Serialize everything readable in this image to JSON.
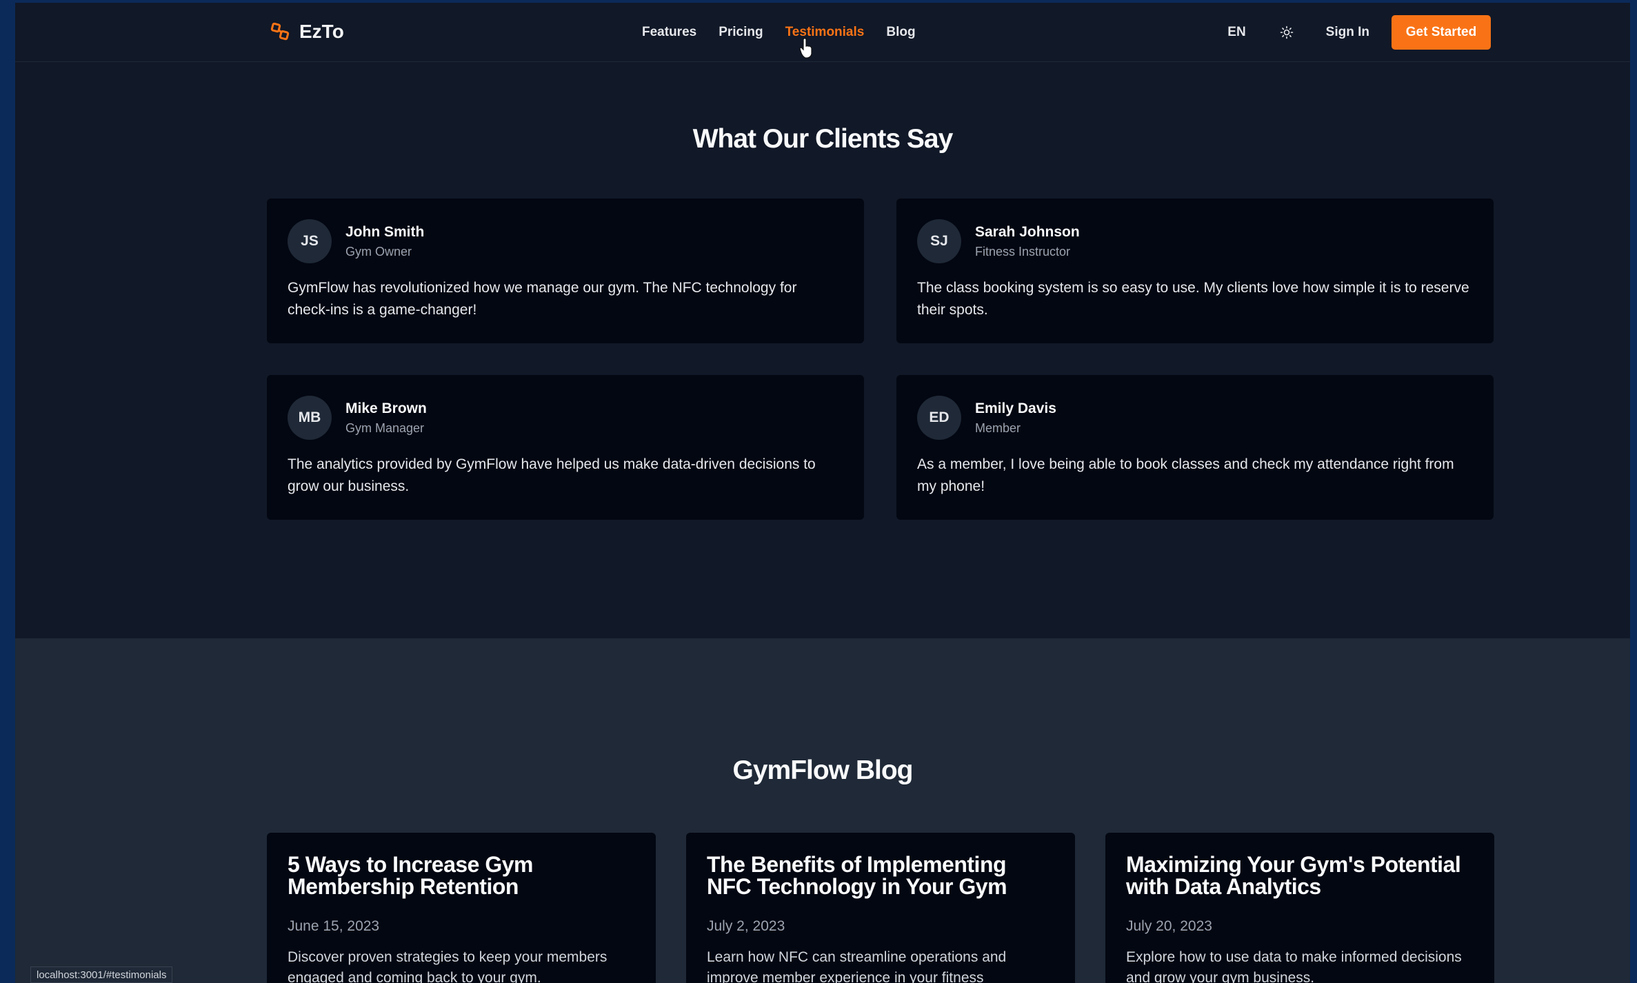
{
  "nav": {
    "brand": "EzTo",
    "links": [
      "Features",
      "Pricing",
      "Testimonials",
      "Blog"
    ],
    "active_link": "Testimonials",
    "lang": "EN",
    "sign_in": "Sign In",
    "cta": "Get Started",
    "accent_color": "#f97316"
  },
  "testimonials": {
    "title": "What Our Clients Say",
    "items": [
      {
        "initials": "JS",
        "name": "John Smith",
        "role": "Gym Owner",
        "quote": "GymFlow has revolutionized how we manage our gym. The NFC technology for check-ins is a game-changer!"
      },
      {
        "initials": "SJ",
        "name": "Sarah Johnson",
        "role": "Fitness Instructor",
        "quote": "The class booking system is so easy to use. My clients love how simple it is to reserve their spots."
      },
      {
        "initials": "MB",
        "name": "Mike Brown",
        "role": "Gym Manager",
        "quote": "The analytics provided by GymFlow have helped us make data-driven decisions to grow our business."
      },
      {
        "initials": "ED",
        "name": "Emily Davis",
        "role": "Member",
        "quote": "As a member, I love being able to book classes and check my attendance right from my phone!"
      }
    ]
  },
  "blog": {
    "title": "GymFlow Blog",
    "posts": [
      {
        "title": "5 Ways to Increase Gym Membership Retention",
        "date": "June 15, 2023",
        "excerpt": "Discover proven strategies to keep your members engaged and coming back to your gym."
      },
      {
        "title": "The Benefits of Implementing NFC Technology in Your Gym",
        "date": "July 2, 2023",
        "excerpt": "Learn how NFC can streamline operations and improve member experience in your fitness"
      },
      {
        "title": "Maximizing Your Gym's Potential with Data Analytics",
        "date": "July 20, 2023",
        "excerpt": "Explore how to use data to make informed decisions and grow your gym business."
      }
    ]
  },
  "status_bar": {
    "url": "localhost:3001/#testimonials"
  }
}
